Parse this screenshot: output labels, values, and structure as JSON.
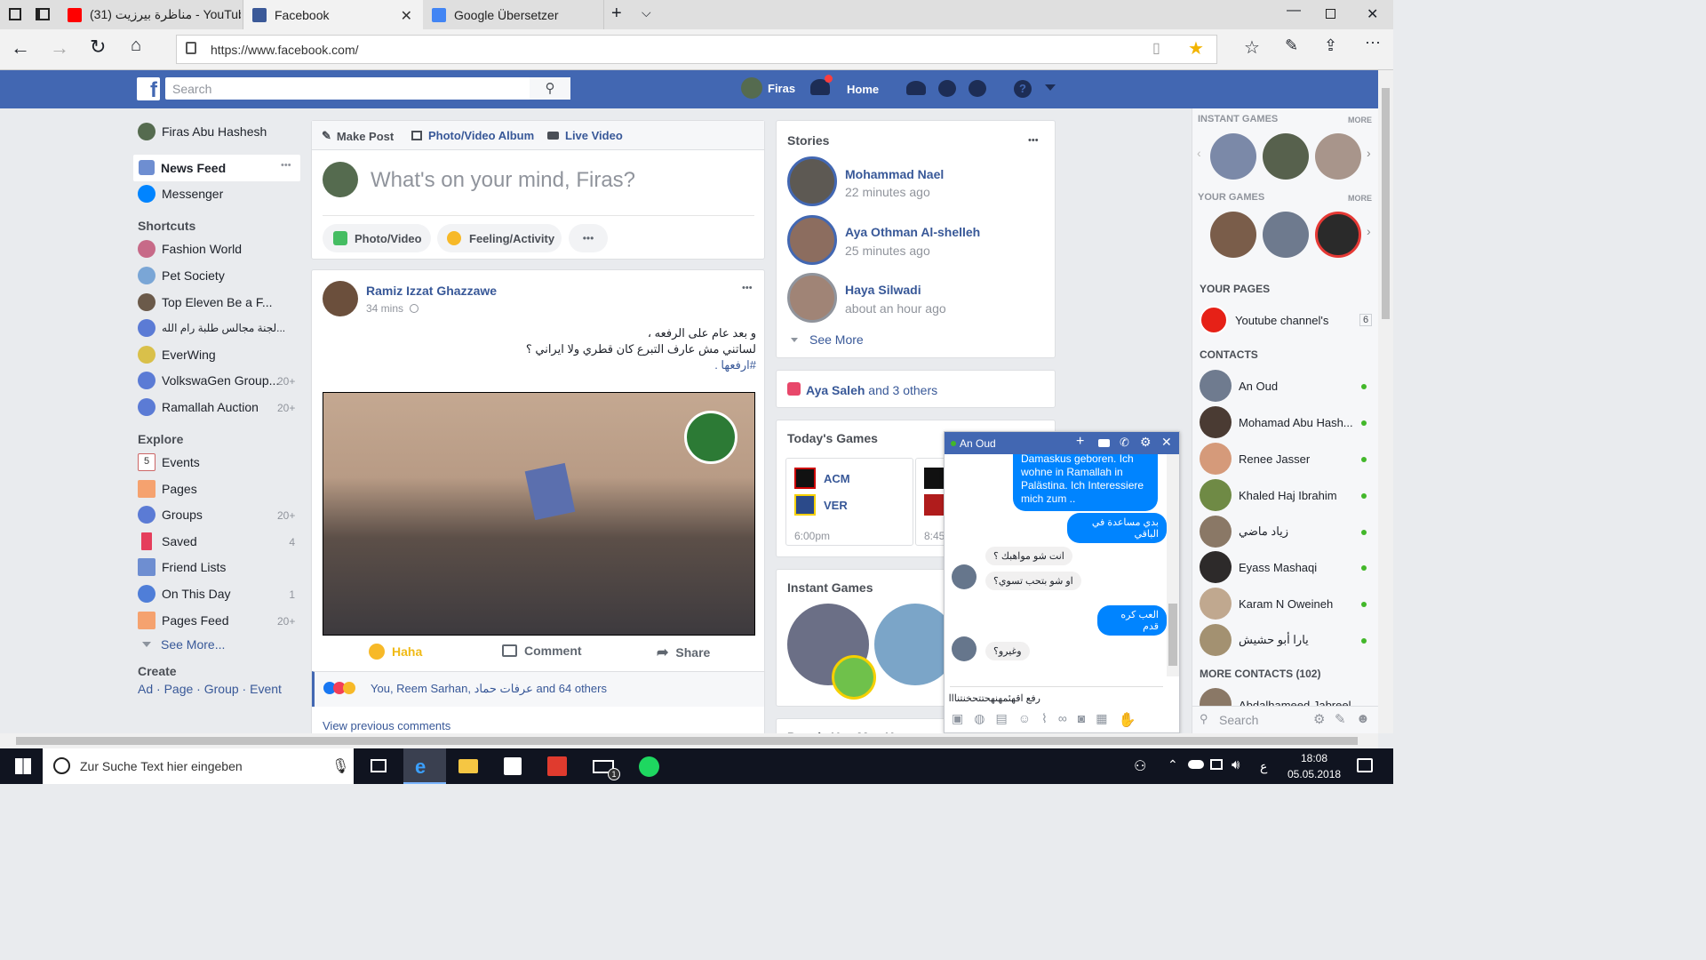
{
  "browser": {
    "tabs": [
      {
        "label": "(31) مناظرة بيرزيت - YouTub"
      },
      {
        "label": "Facebook"
      },
      {
        "label": "Google Übersetzer"
      }
    ],
    "url": "https://www.facebook.com/"
  },
  "fb_header": {
    "search_placeholder": "Search",
    "user_name": "Firas",
    "home_label": "Home"
  },
  "left_nav": {
    "profile_name": "Firas Abu Hashesh",
    "news_feed": "News Feed",
    "more_dots": "•••",
    "messenger": "Messenger",
    "shortcuts_title": "Shortcuts",
    "shortcuts": [
      {
        "label": "Fashion World",
        "count": ""
      },
      {
        "label": "Pet Society",
        "count": ""
      },
      {
        "label": "Top Eleven Be a F...",
        "count": ""
      },
      {
        "label": "لجنة مجالس طلبة رام الله...",
        "count": ""
      },
      {
        "label": "EverWing",
        "count": ""
      },
      {
        "label": "VolkswaGen Group...",
        "count": "20+"
      },
      {
        "label": "Ramallah Auction",
        "count": "20+"
      }
    ],
    "explore_title": "Explore",
    "explore": [
      {
        "label": "Events",
        "count": ""
      },
      {
        "label": "Pages",
        "count": ""
      },
      {
        "label": "Groups",
        "count": "20+"
      },
      {
        "label": "Saved",
        "count": "4"
      },
      {
        "label": "Friend Lists",
        "count": ""
      },
      {
        "label": "On This Day",
        "count": "1"
      },
      {
        "label": "Pages Feed",
        "count": "20+"
      }
    ],
    "see_more": "See More...",
    "create_title": "Create",
    "create_links": {
      "ad": "Ad",
      "page": "Page",
      "group": "Group",
      "event": "Event"
    },
    "events_icon_day": "5"
  },
  "composer": {
    "make_post": "Make Post",
    "photo_album": "Photo/Video Album",
    "live_video": "Live Video",
    "placeholder": "What's on your mind, Firas?",
    "photo_video": "Photo/Video",
    "feeling": "Feeling/Activity",
    "more": "•••"
  },
  "post": {
    "author": "Ramiz Izzat Ghazzawe",
    "time": "34 mins",
    "menu": "•••",
    "text_line1": "و بعد عام على الرفعه ،",
    "text_line2": "لساتني مش عارف التبرع كان قطري ولا ايراني ؟",
    "text_line3": "#ارفعها .",
    "reaction_label": "Haha",
    "comment_label": "Comment",
    "share_label": "Share",
    "reactions_summary": "You, Reem Sarhan, عرفات حماد and 64 others",
    "view_comments": "View previous comments"
  },
  "stories": {
    "title": "Stories",
    "menu": "•••",
    "items": [
      {
        "name": "Mohammad Nael",
        "time": "22 minutes ago"
      },
      {
        "name": "Aya Othman Al-shelleh",
        "time": "25 minutes ago"
      },
      {
        "name": "Haya Silwadi",
        "time": "about an hour ago"
      }
    ],
    "see_more": "See More"
  },
  "birthdays": {
    "name": "Aya Saleh",
    "rest": "and 3 others"
  },
  "todays_games": {
    "title": "Today's Games",
    "match1": {
      "team1": "ACM",
      "team2": "VER",
      "time": "6:00pm"
    },
    "match2": {
      "time": "8:45"
    }
  },
  "instant_games_mid": {
    "title": "Instant Games"
  },
  "people_you_may_know": {
    "title": "People You May Know"
  },
  "chat": {
    "contact_name": "An Oud",
    "messages": [
      {
        "from": "me",
        "text": "Damaskus geboren. Ich wohne in Ramallah in Palästina. Ich Interessiere mich zum .."
      },
      {
        "from": "me",
        "text": "بدي مساعدة في الباقي"
      },
      {
        "from": "them",
        "text": "انت شو مواهبك ؟"
      },
      {
        "from": "them",
        "text": "او شو بتحب تسوي؟"
      },
      {
        "from": "me",
        "text": "العب كره قدم"
      },
      {
        "from": "them",
        "text": "وغيرو؟"
      }
    ],
    "input_value": "رفع اقهئمهنهحتتحخنتنااا"
  },
  "right_sidebar": {
    "instant_games_title": "INSTANT GAMES",
    "more1": "MORE",
    "your_games_title": "YOUR GAMES",
    "more2": "MORE",
    "your_pages_title": "YOUR PAGES",
    "page_name": "Youtube channel's",
    "page_count": "6",
    "contacts_title": "CONTACTS",
    "contacts": [
      {
        "name": "An Oud"
      },
      {
        "name": "Mohamad Abu Hash..."
      },
      {
        "name": "Renee Jasser"
      },
      {
        "name": "Khaled Haj Ibrahim"
      },
      {
        "name": "زياد ماضي"
      },
      {
        "name": "Eyass Mashaqi"
      },
      {
        "name": "Karam N Oweineh"
      },
      {
        "name": "يارا أبو حشيش"
      }
    ],
    "more_contacts": "MORE CONTACTS (102)",
    "partial_contact": "Abdalhameed Jabreel",
    "search_placeholder": "Search"
  },
  "taskbar": {
    "search_placeholder": "Zur Suche Text hier eingeben",
    "time": "18:08",
    "date": "05.05.2018",
    "lang": "ع",
    "mail_badge": "1"
  },
  "colors": {
    "fb_blue": "#4267b2",
    "link_blue": "#385898",
    "messenger_blue": "#0084ff",
    "online_green": "#42b72a"
  }
}
